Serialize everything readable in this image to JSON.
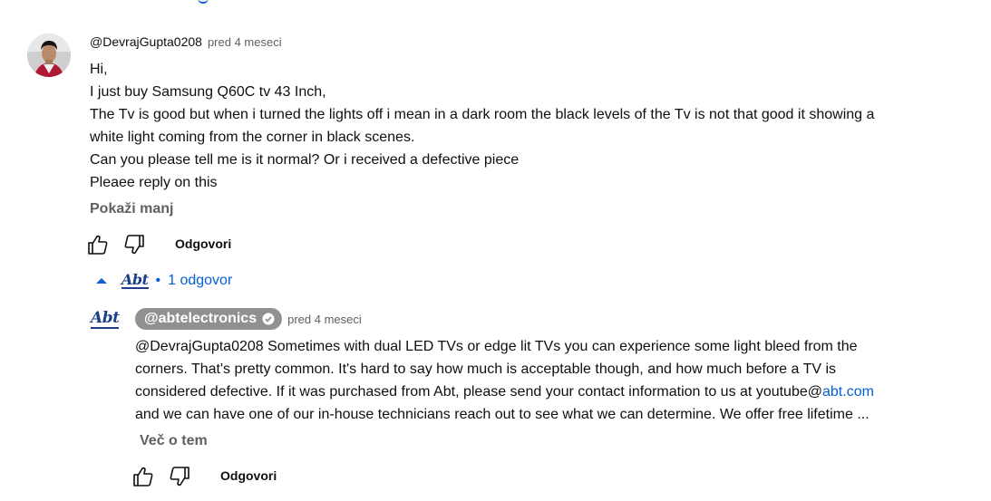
{
  "comment": {
    "author": "@DevrajGupta0208",
    "time": "pred 4 meseci",
    "lines": [
      "Hi,",
      "I just buy Samsung Q60C tv 43 Inch,",
      "The Tv is good but when i turned the lights off i mean in a dark room the black levels of the Tv is not that good it showing a",
      "white light coming from the corner in black scenes.",
      "Can you please tell me is it normal? Or i received a defective piece",
      "Pleaee reply on this"
    ],
    "show_less": "Pokaži manj",
    "reply_label": "Odgovori",
    "icons": {
      "like": "thumb-up-icon",
      "dislike": "thumb-down-icon"
    }
  },
  "replies_toggle": {
    "logo_text": "Abt",
    "separator": "•",
    "label": "1 odgovor",
    "icon": "caret-up-icon",
    "color": "#065fd4"
  },
  "reply": {
    "logo_text": "Abt",
    "author": "@abtelectronics",
    "verified_icon": "verified-check-icon",
    "time": "pred 4 meseci",
    "line1": "@DevrajGupta0208 Sometimes with dual LED TVs or edge lit TVs you can experience some light bleed from the",
    "line2": "corners. That's pretty common. It's hard to say how much is acceptable though, and how much before a TV is",
    "line3_prefix": "considered defective. If it was purchased from Abt, please send your contact information to us at youtube@",
    "line3_link": "abt.com",
    "line4": "and we can have one of our in-house technicians reach out to see what we can determine. We offer free lifetime ...",
    "read_more": "Več o tem",
    "reply_label": "Odgovori",
    "chip_color": "#909090"
  }
}
